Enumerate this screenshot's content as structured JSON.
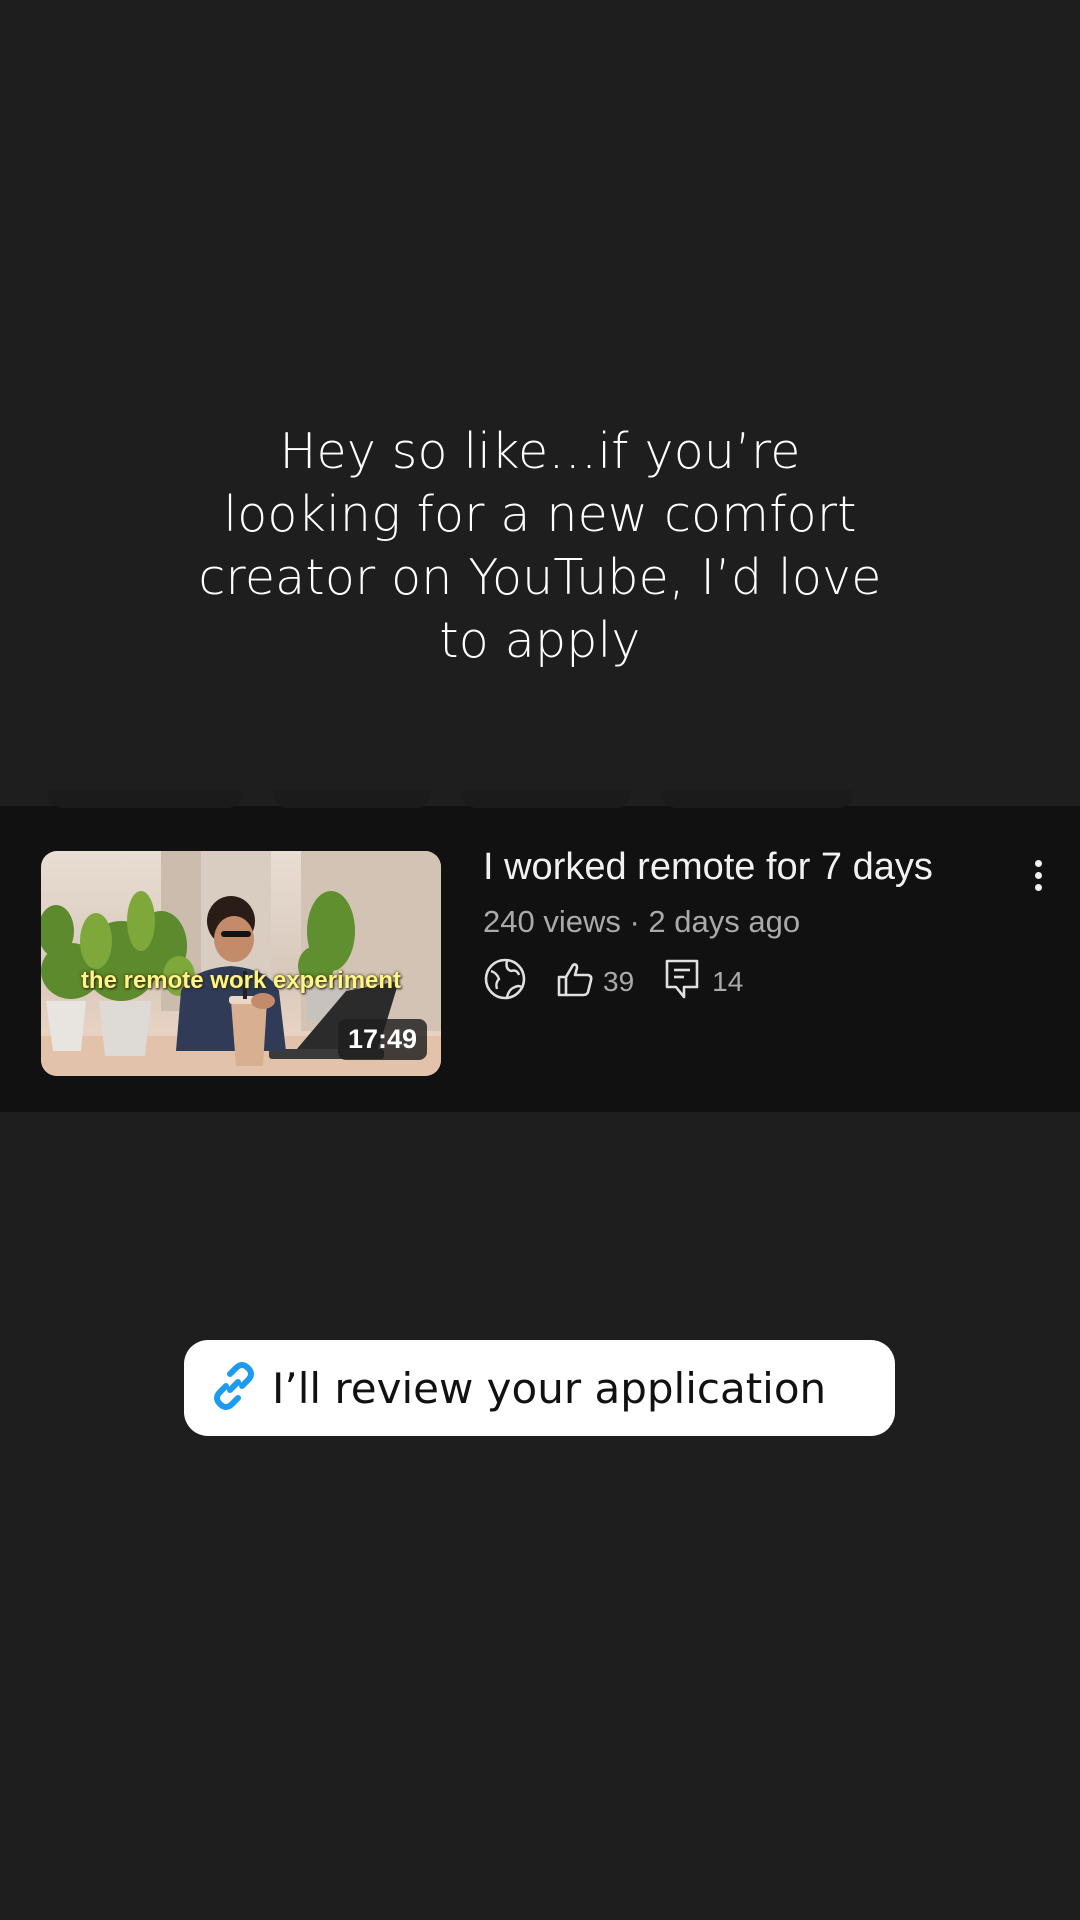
{
  "caption": {
    "text": "Hey so like…if you’re looking for a new comfort creator on YouTube, I’d love to apply"
  },
  "video": {
    "thumbnail_text": "the remote work experiment",
    "duration": "17:49",
    "title": "I worked remote for 7 days",
    "meta": "240 views · 2 days ago",
    "visibility_icon": "globe-icon",
    "likes": "39",
    "comments": "14",
    "menu_icon": "more-vert-icon"
  },
  "link_sticker": {
    "icon": "link-icon",
    "label": "I’ll review your application",
    "icon_color": "#1d9bf0"
  }
}
